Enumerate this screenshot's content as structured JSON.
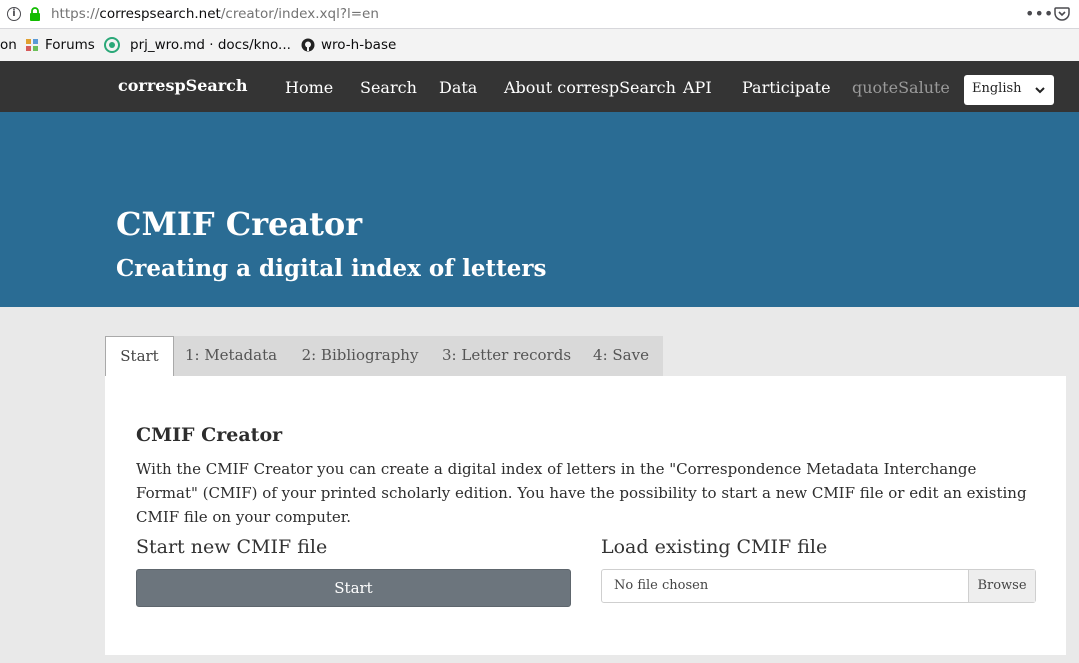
{
  "browser": {
    "url_prefix": "https://",
    "url_domain": "correspsearch.net",
    "url_path": "/creator/index.xql?l=en",
    "menu_dots": "•••"
  },
  "bookmarks": {
    "items": [
      {
        "label": "on"
      },
      {
        "label": "Forums"
      },
      {
        "label": "prj_wro.md · docs/kno..."
      },
      {
        "label": "wro-h-base"
      }
    ]
  },
  "navbar": {
    "brand": "correspSearch",
    "links": [
      {
        "label": "Home"
      },
      {
        "label": "Search"
      },
      {
        "label": "Data"
      },
      {
        "label": "About correspSearch"
      },
      {
        "label": "API"
      },
      {
        "label": "Participate"
      },
      {
        "label": "quoteSalute"
      }
    ],
    "language": "English"
  },
  "hero": {
    "title": "CMIF Creator",
    "subtitle": "Creating a digital index of letters"
  },
  "tabs": [
    {
      "label": "Start",
      "active": true
    },
    {
      "label": "1: Metadata"
    },
    {
      "label": "2: Bibliography"
    },
    {
      "label": "3: Letter records"
    },
    {
      "label": "4: Save"
    }
  ],
  "panel": {
    "title": "CMIF Creator",
    "description": "With the CMIF Creator you can create a digital index of letters in the \"Correspondence Metadata Interchange Format\" (CMIF) of your printed scholarly edition. You have the possibility to start a new CMIF file or edit an existing CMIF file on your computer.",
    "new_heading": "Start new CMIF file",
    "start_button": "Start",
    "load_heading": "Load existing CMIF file",
    "file_placeholder": "No file chosen",
    "browse_button": "Browse"
  },
  "colors": {
    "navbar": "#343434",
    "hero": "#2a6c94",
    "button": "#6c757d"
  }
}
